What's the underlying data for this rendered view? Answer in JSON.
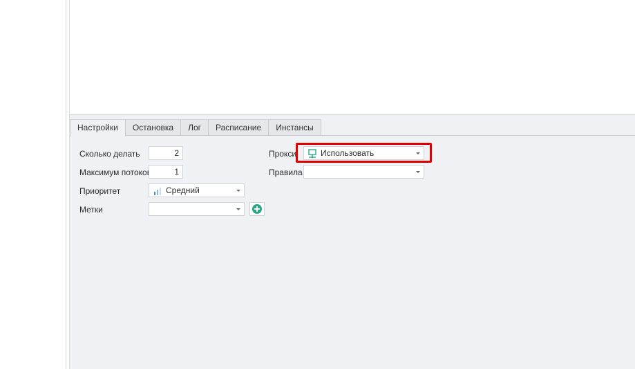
{
  "tabs": [
    {
      "label": "Настройки",
      "active": true
    },
    {
      "label": "Остановка",
      "active": false
    },
    {
      "label": "Лог",
      "active": false
    },
    {
      "label": "Расписание",
      "active": false
    },
    {
      "label": "Инстансы",
      "active": false
    }
  ],
  "settings": {
    "count_label": "Сколько делать",
    "count_value": "2",
    "threads_label": "Максимум потоков",
    "threads_value": "1",
    "priority_label": "Приоритет",
    "priority_value": "Средний",
    "priority_icon": "bar-chart-icon",
    "tags_label": "Метки",
    "tags_value": "",
    "proxy_label": "Прокси",
    "proxy_value": "Использовать",
    "proxy_icon": "network-icon",
    "rules_label": "Правила",
    "rules_value": ""
  },
  "colors": {
    "accent_green": "#2aa882",
    "highlight_red": "#e00000",
    "panel_bg": "#f0f1f5"
  }
}
